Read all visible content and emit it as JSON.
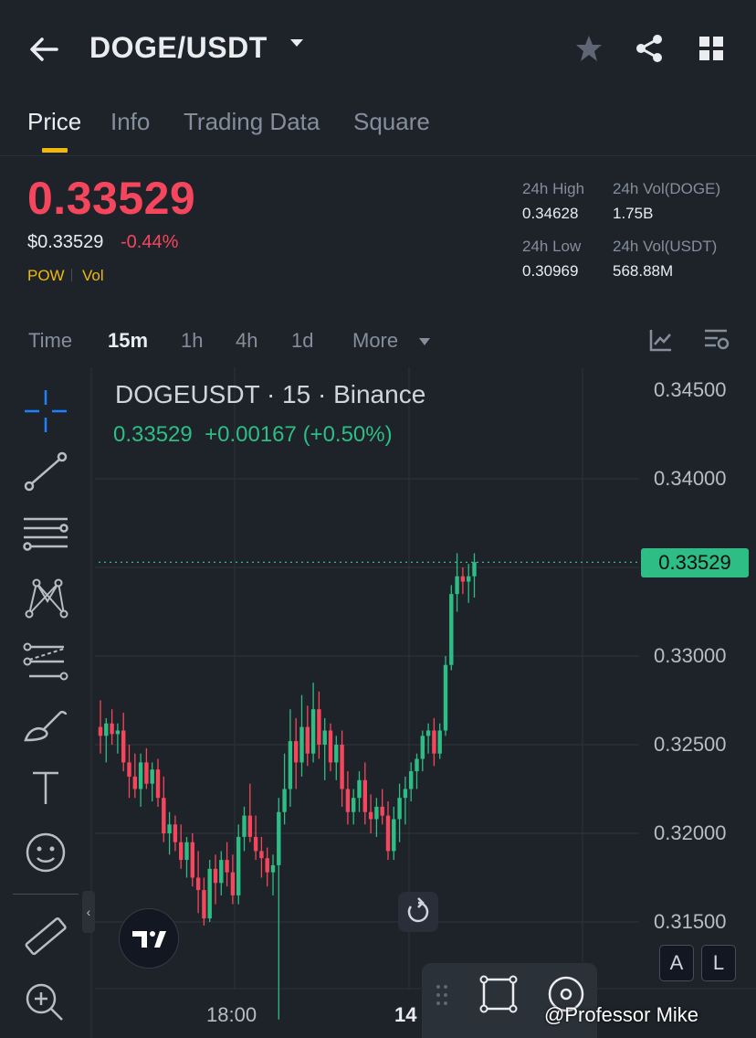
{
  "header": {
    "pair": "DOGE/USDT"
  },
  "tabs": [
    {
      "label": "Price",
      "active": true
    },
    {
      "label": "Info",
      "active": false
    },
    {
      "label": "Trading Data",
      "active": false
    },
    {
      "label": "Square",
      "active": false
    }
  ],
  "ticker": {
    "last_price": "0.33529",
    "usd_price": "$0.33529",
    "change_pct": "-0.44%",
    "tags": [
      "POW",
      "Vol"
    ],
    "stats": [
      {
        "label": "24h High",
        "value": "0.34628"
      },
      {
        "label": "24h Vol(DOGE)",
        "value": "1.75B"
      },
      {
        "label": "24h Low",
        "value": "0.30969"
      },
      {
        "label": "24h Vol(USDT)",
        "value": "568.88M"
      }
    ]
  },
  "intervals": [
    {
      "label": "Time",
      "active": false
    },
    {
      "label": "15m",
      "active": true
    },
    {
      "label": "1h",
      "active": false
    },
    {
      "label": "4h",
      "active": false
    },
    {
      "label": "1d",
      "active": false
    },
    {
      "label": "More",
      "active": false
    }
  ],
  "chart_header": {
    "title": "DOGEUSDT · 15 · Binance",
    "last": "0.33529",
    "change": "+0.00167",
    "change_pct": "(+0.50%)"
  },
  "chart_data": {
    "type": "candlestick",
    "symbol": "DOGEUSDT",
    "interval": "15",
    "exchange": "Binance",
    "y_ticks": [
      "0.34500",
      "0.34000",
      "0.33500",
      "0.33000",
      "0.32500",
      "0.32000",
      "0.31500"
    ],
    "x_ticks": [
      "18:00",
      "14"
    ],
    "ylim": [
      0.311,
      0.346
    ],
    "current_price": 0.33529,
    "candles": [
      {
        "o": 0.326,
        "h": 0.3275,
        "l": 0.3245,
        "c": 0.3255
      },
      {
        "o": 0.3255,
        "h": 0.3265,
        "l": 0.324,
        "c": 0.3262
      },
      {
        "o": 0.3262,
        "h": 0.327,
        "l": 0.325,
        "c": 0.3256
      },
      {
        "o": 0.3256,
        "h": 0.3262,
        "l": 0.3245,
        "c": 0.3258
      },
      {
        "o": 0.3258,
        "h": 0.3268,
        "l": 0.3235,
        "c": 0.324
      },
      {
        "o": 0.324,
        "h": 0.325,
        "l": 0.322,
        "c": 0.3232
      },
      {
        "o": 0.3232,
        "h": 0.3245,
        "l": 0.322,
        "c": 0.3225
      },
      {
        "o": 0.3225,
        "h": 0.3245,
        "l": 0.3215,
        "c": 0.324
      },
      {
        "o": 0.324,
        "h": 0.3248,
        "l": 0.3225,
        "c": 0.3228
      },
      {
        "o": 0.3228,
        "h": 0.324,
        "l": 0.3218,
        "c": 0.3236
      },
      {
        "o": 0.3236,
        "h": 0.3242,
        "l": 0.3215,
        "c": 0.322
      },
      {
        "o": 0.322,
        "h": 0.3232,
        "l": 0.3195,
        "c": 0.32
      },
      {
        "o": 0.32,
        "h": 0.3212,
        "l": 0.3188,
        "c": 0.3205
      },
      {
        "o": 0.3205,
        "h": 0.321,
        "l": 0.319,
        "c": 0.3195
      },
      {
        "o": 0.3195,
        "h": 0.3205,
        "l": 0.318,
        "c": 0.3185
      },
      {
        "o": 0.3185,
        "h": 0.3198,
        "l": 0.3175,
        "c": 0.3195
      },
      {
        "o": 0.3195,
        "h": 0.32,
        "l": 0.317,
        "c": 0.3175
      },
      {
        "o": 0.3175,
        "h": 0.319,
        "l": 0.3155,
        "c": 0.3168
      },
      {
        "o": 0.3168,
        "h": 0.3175,
        "l": 0.3148,
        "c": 0.3152
      },
      {
        "o": 0.3152,
        "h": 0.3185,
        "l": 0.315,
        "c": 0.318
      },
      {
        "o": 0.318,
        "h": 0.3188,
        "l": 0.316,
        "c": 0.3172
      },
      {
        "o": 0.3172,
        "h": 0.319,
        "l": 0.3165,
        "c": 0.3185
      },
      {
        "o": 0.3185,
        "h": 0.3195,
        "l": 0.317,
        "c": 0.3178
      },
      {
        "o": 0.3178,
        "h": 0.3188,
        "l": 0.316,
        "c": 0.3165
      },
      {
        "o": 0.3165,
        "h": 0.3205,
        "l": 0.316,
        "c": 0.3198
      },
      {
        "o": 0.3198,
        "h": 0.3215,
        "l": 0.319,
        "c": 0.321
      },
      {
        "o": 0.321,
        "h": 0.3228,
        "l": 0.3195,
        "c": 0.3198
      },
      {
        "o": 0.3198,
        "h": 0.321,
        "l": 0.3185,
        "c": 0.319
      },
      {
        "o": 0.319,
        "h": 0.3198,
        "l": 0.3175,
        "c": 0.3186
      },
      {
        "o": 0.3186,
        "h": 0.3192,
        "l": 0.317,
        "c": 0.3178
      },
      {
        "o": 0.3178,
        "h": 0.3188,
        "l": 0.3165,
        "c": 0.3182
      },
      {
        "o": 0.3182,
        "h": 0.322,
        "l": 0.3095,
        "c": 0.3212
      },
      {
        "o": 0.3212,
        "h": 0.3245,
        "l": 0.3205,
        "c": 0.3225
      },
      {
        "o": 0.3225,
        "h": 0.327,
        "l": 0.3215,
        "c": 0.3252
      },
      {
        "o": 0.3252,
        "h": 0.3265,
        "l": 0.3225,
        "c": 0.324
      },
      {
        "o": 0.324,
        "h": 0.3278,
        "l": 0.3232,
        "c": 0.326
      },
      {
        "o": 0.326,
        "h": 0.3272,
        "l": 0.3238,
        "c": 0.3245
      },
      {
        "o": 0.3245,
        "h": 0.3285,
        "l": 0.324,
        "c": 0.327
      },
      {
        "o": 0.327,
        "h": 0.328,
        "l": 0.3242,
        "c": 0.325
      },
      {
        "o": 0.325,
        "h": 0.3265,
        "l": 0.323,
        "c": 0.3258
      },
      {
        "o": 0.3258,
        "h": 0.3262,
        "l": 0.3235,
        "c": 0.324
      },
      {
        "o": 0.324,
        "h": 0.3255,
        "l": 0.323,
        "c": 0.325
      },
      {
        "o": 0.325,
        "h": 0.3258,
        "l": 0.3215,
        "c": 0.3225
      },
      {
        "o": 0.3225,
        "h": 0.3235,
        "l": 0.3205,
        "c": 0.3212
      },
      {
        "o": 0.3212,
        "h": 0.3225,
        "l": 0.3205,
        "c": 0.322
      },
      {
        "o": 0.322,
        "h": 0.3235,
        "l": 0.3212,
        "c": 0.323
      },
      {
        "o": 0.323,
        "h": 0.324,
        "l": 0.3205,
        "c": 0.3212
      },
      {
        "o": 0.3212,
        "h": 0.3222,
        "l": 0.32,
        "c": 0.3208
      },
      {
        "o": 0.3208,
        "h": 0.322,
        "l": 0.3198,
        "c": 0.3215
      },
      {
        "o": 0.3215,
        "h": 0.3225,
        "l": 0.3205,
        "c": 0.321
      },
      {
        "o": 0.321,
        "h": 0.3218,
        "l": 0.3185,
        "c": 0.319
      },
      {
        "o": 0.319,
        "h": 0.3215,
        "l": 0.3185,
        "c": 0.3208
      },
      {
        "o": 0.3208,
        "h": 0.3228,
        "l": 0.3195,
        "c": 0.322
      },
      {
        "o": 0.322,
        "h": 0.3232,
        "l": 0.3205,
        "c": 0.3225
      },
      {
        "o": 0.3225,
        "h": 0.324,
        "l": 0.3218,
        "c": 0.3235
      },
      {
        "o": 0.3235,
        "h": 0.3245,
        "l": 0.3225,
        "c": 0.3242
      },
      {
        "o": 0.3242,
        "h": 0.3258,
        "l": 0.3235,
        "c": 0.3255
      },
      {
        "o": 0.3255,
        "h": 0.3262,
        "l": 0.3245,
        "c": 0.3258
      },
      {
        "o": 0.3258,
        "h": 0.3265,
        "l": 0.3238,
        "c": 0.3245
      },
      {
        "o": 0.3245,
        "h": 0.3262,
        "l": 0.3242,
        "c": 0.3258
      },
      {
        "o": 0.3258,
        "h": 0.33,
        "l": 0.3255,
        "c": 0.3295
      },
      {
        "o": 0.3295,
        "h": 0.334,
        "l": 0.3292,
        "c": 0.3335
      },
      {
        "o": 0.3335,
        "h": 0.3358,
        "l": 0.3325,
        "c": 0.3345
      },
      {
        "o": 0.3345,
        "h": 0.335,
        "l": 0.3335,
        "c": 0.3342
      },
      {
        "o": 0.3342,
        "h": 0.3352,
        "l": 0.333,
        "c": 0.3345
      },
      {
        "o": 0.3345,
        "h": 0.3358,
        "l": 0.3333,
        "c": 0.3353
      }
    ]
  },
  "chart_overlay": {
    "current_price_badge": "0.33529",
    "scale_modes": [
      "A",
      "L"
    ],
    "watermark": "@Professor Mike"
  },
  "colors": {
    "up": "#2ebd85",
    "down": "#f6465d",
    "accent": "#f0b90b",
    "background": "#1e2329",
    "grid": "#2b3139"
  },
  "icons": [
    "back-arrow-icon",
    "dropdown-caret-icon",
    "star-icon",
    "share-icon",
    "grid-menu-icon",
    "chart-style-icon",
    "indicator-settings-icon",
    "crosshair-icon",
    "trend-line-icon",
    "fib-levels-icon",
    "pattern-icon",
    "channel-icon",
    "brush-icon",
    "text-icon",
    "emoji-icon",
    "ruler-icon",
    "zoom-in-icon",
    "reset-icon"
  ]
}
